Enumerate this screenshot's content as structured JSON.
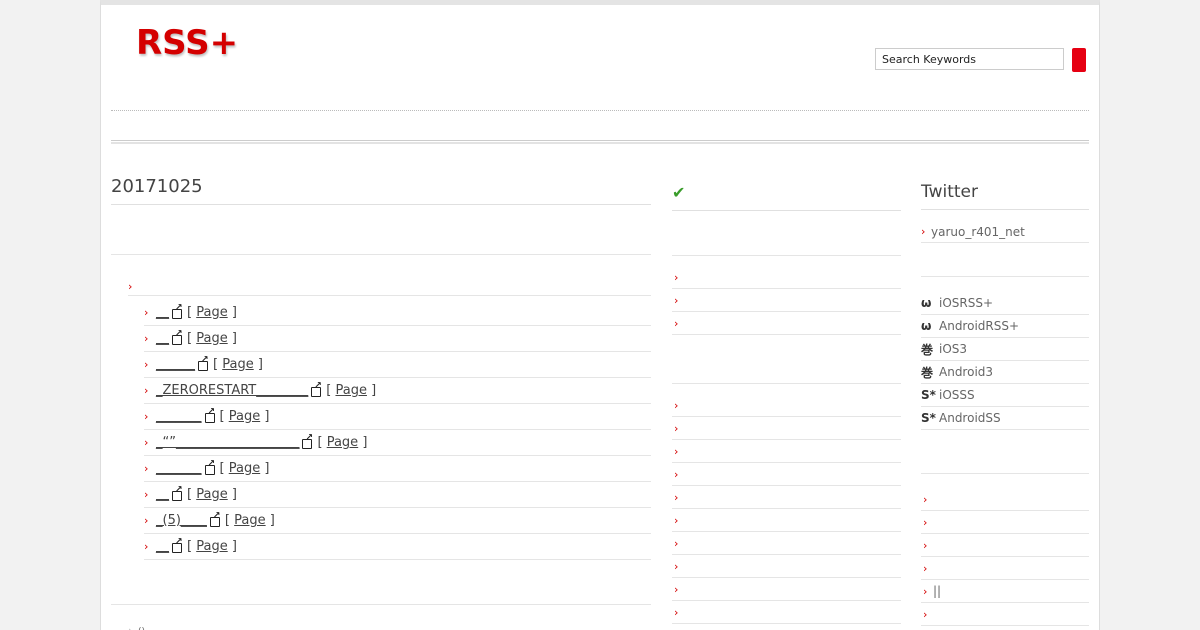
{
  "header": {
    "logo": "RSS+",
    "search_placeholder": "Search Keywords"
  },
  "main": {
    "title": "20171025",
    "top_item": "",
    "links": [
      {
        "text": "__",
        "page": "Page"
      },
      {
        "text": "__",
        "page": "Page"
      },
      {
        "text": "______",
        "page": "Page"
      },
      {
        "text": "_ZERORESTART________",
        "page": "Page"
      },
      {
        "text": "_______",
        "page": "Page"
      },
      {
        "text": "_“”___________________",
        "page": "Page"
      },
      {
        "text": "_______",
        "page": "Page"
      },
      {
        "text": "__",
        "page": "Page"
      },
      {
        "text": "_(5)____",
        "page": "Page"
      },
      {
        "text": "__",
        "page": "Page"
      }
    ],
    "bottom_item": "()"
  },
  "middle": {
    "header_icon": "checkmark-icon",
    "list1_count_label": "",
    "list2_count_label": ""
  },
  "sidebar": {
    "twitter_title": "Twitter",
    "twitter_account": "yaruo_r401_net",
    "apps": [
      {
        "icon": "ω",
        "label": "iOSRSS+"
      },
      {
        "icon": "ω",
        "label": "AndroidRSS+"
      },
      {
        "icon": "巻",
        "label": "iOS3"
      },
      {
        "icon": "巻",
        "label": "Android3"
      },
      {
        "icon": "S*",
        "label": "iOSSS"
      },
      {
        "icon": "S*",
        "label": "AndroidSS"
      }
    ],
    "links": [
      "",
      "",
      "",
      "",
      "||",
      "",
      ""
    ]
  },
  "colors": {
    "accent": "#d40000",
    "button": "#e60012",
    "check": "#3a9d2b"
  }
}
